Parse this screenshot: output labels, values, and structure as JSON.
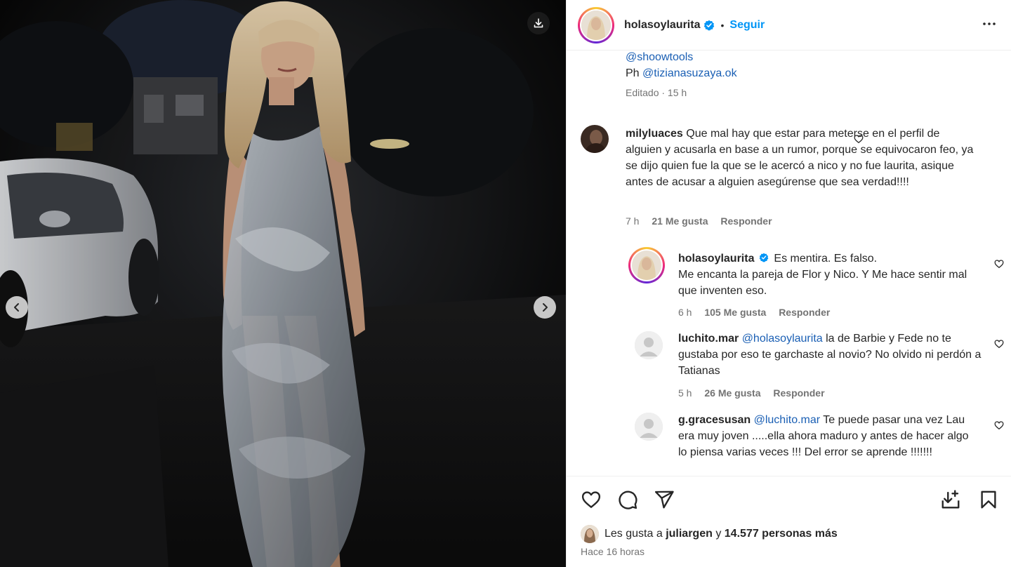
{
  "post": {
    "username": "holasoylaurita",
    "follow_label": "Seguir",
    "separator": "•"
  },
  "caption": {
    "mention_1": "@shoowtools",
    "ph_prefix": "Ph",
    "mention_2": "@tizianasuzaya.ok",
    "edited": "Editado · 15 h"
  },
  "comments": [
    {
      "username": "milyluaces",
      "text": "Que mal hay que estar para meterse en el perfil de alguien y acusarla en base a un rumor, porque se equivocaron feo, ya se dijo quien fue la que se le acercó a nico y no fue laurita, asique antes de acusar a alguien asegúrense que sea verdad!!!!",
      "time": "7 h",
      "likes": "21 Me gusta",
      "reply": "Responder"
    },
    {
      "username": "holasoylaurita",
      "text_line1": "Es mentira. Es falso.",
      "text_rest": "Me encanta la pareja de Flor y Nico. Y Me hace sentir mal que inventen eso.",
      "time": "6 h",
      "likes": "105 Me gusta",
      "reply": "Responder"
    },
    {
      "username": "luchito.mar",
      "mention": "@holasoylaurita",
      "text": "la de Barbie y Fede no te gustaba por eso te garchaste al novio? No olvido ni perdón a Tatianas",
      "time": "5 h",
      "likes": "26 Me gusta",
      "reply": "Responder"
    },
    {
      "username": "g.gracesusan",
      "mention": "@luchito.mar",
      "text": "Te puede pasar una vez Lau era muy joven .....ella ahora maduro y antes de hacer algo lo piensa varias veces !!! Del error se aprende !!!!!!!"
    }
  ],
  "likes_summary": {
    "prefix": "Les gusta a",
    "user": "juliargen",
    "conj": "y",
    "others": "14.577 personas más"
  },
  "post_time": "Hace 16 horas",
  "icons": {
    "like": "heart-icon",
    "comment": "comment-icon",
    "share": "paper-plane-icon",
    "save": "bookmark-icon",
    "download": "download-icon",
    "more": "more-horizontal-icon",
    "verified": "verified-badge-icon"
  },
  "colors": {
    "link": "#0095f6",
    "verified": "#0095f6",
    "text": "#262626",
    "secondary": "#737373"
  }
}
